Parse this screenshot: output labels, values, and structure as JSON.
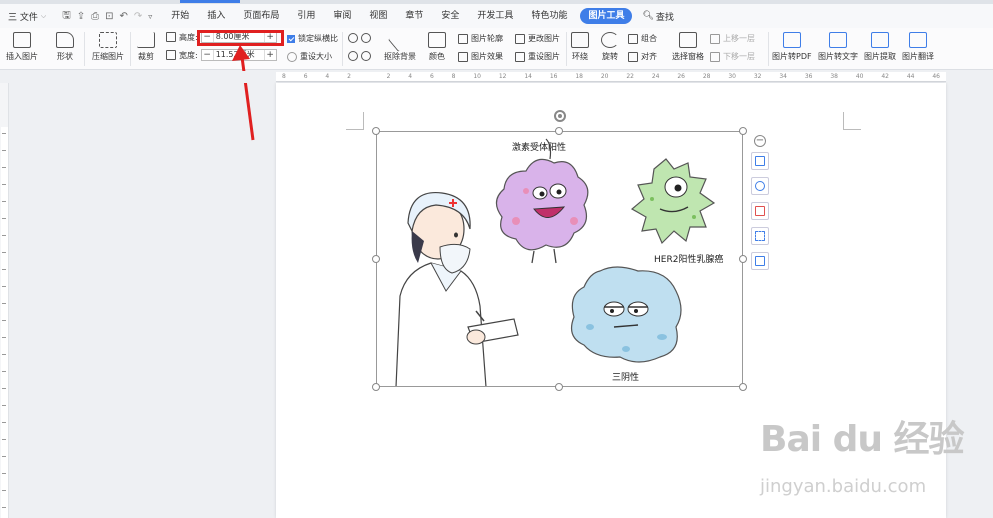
{
  "menu": {
    "file_label": "三 文件",
    "tabs": [
      "开始",
      "插入",
      "页面布局",
      "引用",
      "审阅",
      "视图",
      "章节",
      "安全",
      "开发工具",
      "特色功能"
    ],
    "active_tab": "图片工具",
    "find_label": "查找"
  },
  "ribbon": {
    "insert_picture": "插入图片",
    "shape": "形状",
    "compress": "压缩图片",
    "crop": "裁剪",
    "height_label": "高度:",
    "width_label": "宽度:",
    "height_value": "8.00厘米",
    "width_value": "11.52厘米",
    "lock_ratio": "锁定纵横比",
    "reset_size": "重设大小",
    "remove_bg": "抠除背景",
    "color": "颜色",
    "outline": "图片轮廓",
    "effect": "图片效果",
    "change_picture": "更改图片",
    "reset_picture": "重设图片",
    "wrap": "环绕",
    "rotate": "旋转",
    "group": "组合",
    "align": "对齐",
    "bring_forward": "上移一层",
    "send_backward": "下移一层",
    "selection_pane": "选择窗格",
    "to_pdf": "图片转PDF",
    "to_text": "图片转文字",
    "extract": "图片提取",
    "translate": "图片翻译"
  },
  "ruler_numbers": [
    "8",
    "6",
    "4",
    "2",
    "",
    "2",
    "4",
    "6",
    "8",
    "10",
    "12",
    "14",
    "16",
    "18",
    "20",
    "22",
    "24",
    "26",
    "28",
    "30",
    "32",
    "34",
    "36",
    "38",
    "40",
    "42",
    "44",
    "46"
  ],
  "figure": {
    "label_hormone": "激素受体阳性",
    "label_her2": "HER2阳性乳腺癌",
    "label_triple": "三阴性"
  },
  "watermark": {
    "main": "Bai du 经验",
    "sub": "jingyan.baidu.com"
  },
  "colors": {
    "accent": "#3f7ee8",
    "highlight": "#e02020",
    "purple_cell": "#d9b3ea",
    "green_cell": "#bfe6b0",
    "blue_cell": "#bfdff0"
  }
}
